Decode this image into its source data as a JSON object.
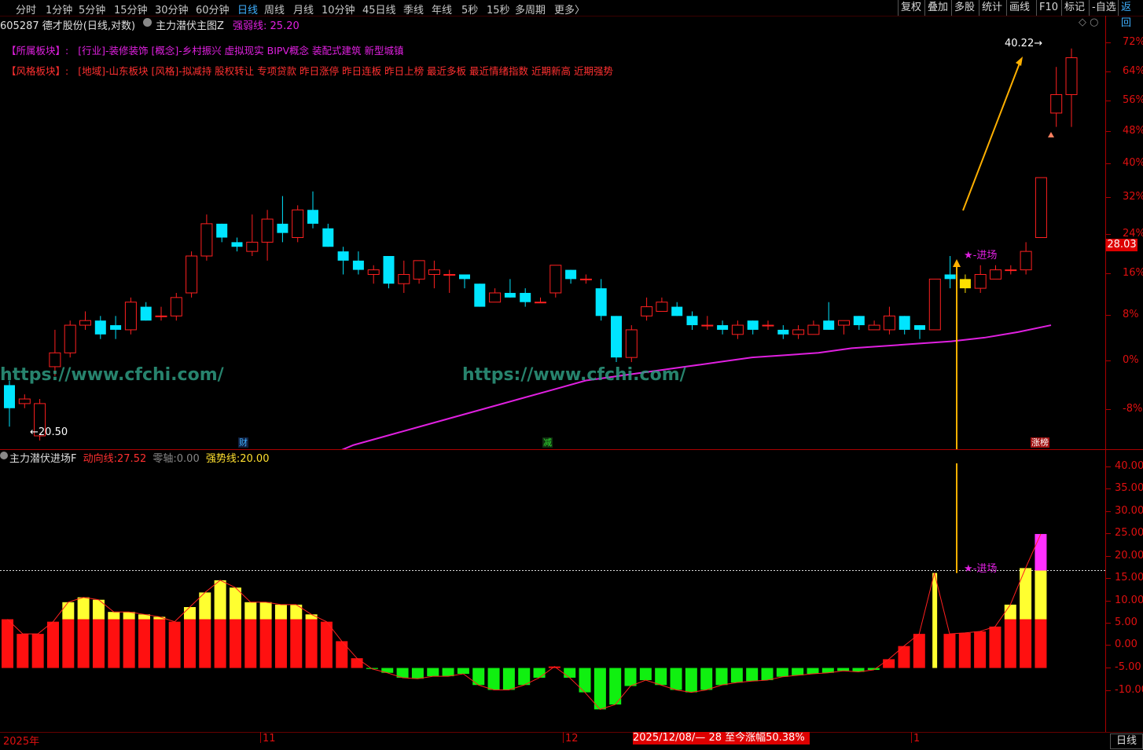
{
  "toolbar": {
    "periods": [
      "分时",
      "1分钟",
      "5分钟",
      "15分钟",
      "30分钟",
      "60分钟",
      "日线",
      "周线",
      "月线",
      "10分钟",
      "45日线",
      "季线",
      "年线",
      "5秒",
      "15秒",
      "多周期",
      "更多〉"
    ],
    "active_period": "日线",
    "right_buttons": [
      "复权",
      "叠加",
      "多股",
      "统计",
      "画线",
      "F10",
      "标记",
      "-自选",
      "返回"
    ]
  },
  "header": {
    "stock_code_title": "605287 德才股份(日线,对数)",
    "main_indicator": "主力潜伏主图Z",
    "strong_weak_label": "强弱线:",
    "strong_weak_value": "25.20"
  },
  "sectors": {
    "line1_tag": "【所属板块】:",
    "line1_text": "[行业]-装修装饰 [概念]-乡村振兴 虚拟现实 BIPV概念 装配式建筑 新型城镇",
    "line2_tag": "【风格板块】:",
    "line2_text": "[地域]-山东板块 [风格]-拟减持 股权转让 专项贷款 昨日涨停 昨日连板 昨日上榜 最近多板 最近情绪指数 近期新高 近期强势"
  },
  "watermark": "https://www.cfchi.com/",
  "price_axis": [
    "72%",
    "64%",
    "56%",
    "48%",
    "40%",
    "32%",
    "24%",
    "16%",
    "8%",
    "0%",
    "-8%"
  ],
  "current_price": "28.03",
  "high_label": "40.22",
  "low_label": "20.50",
  "entry_label": "★-进场",
  "event_markers": [
    "财",
    "减",
    "涨榜"
  ],
  "sub_indicator": {
    "name": "主力潜伏进场F",
    "line1_label": "动向线:",
    "line1_value": "27.52",
    "zero_label": "零轴:",
    "zero_value": "0.00",
    "line2_label": "强势线:",
    "line2_value": "20.00",
    "axis": [
      "40.00",
      "35.00",
      "30.00",
      "25.00",
      "20.00",
      "15.00",
      "10.00",
      "5.00",
      "0.00",
      "-5.00",
      "-10.00"
    ]
  },
  "time_axis": {
    "labels": [
      "2025年",
      "11",
      "12",
      "1"
    ],
    "highlight": "2025/12/08/— 28 至今涨幅50.38%",
    "day_button": "日线"
  },
  "colors": {
    "up": "#ff2020",
    "down": "#00e5ff",
    "highlight_candle": "#ffe000",
    "ma_line": "#e020e0",
    "arrow": "#ffb000",
    "pos_bar": "#ff1010",
    "pos_bar_top": "#ffff30",
    "neg_bar": "#10f010",
    "peak_bar": "#ff30ff"
  },
  "chart_data": {
    "type": "candlestick",
    "candles": [
      {
        "o": -1,
        "c": -6,
        "h": 0,
        "l": -10
      },
      {
        "o": -5,
        "c": -4,
        "h": -3,
        "l": -6
      },
      {
        "o": -12,
        "c": -5,
        "h": -4,
        "l": -13
      },
      {
        "o": 3,
        "c": 6,
        "h": 11,
        "l": 1
      },
      {
        "o": 6,
        "c": 12,
        "h": 13,
        "l": 5
      },
      {
        "o": 12,
        "c": 13,
        "h": 15,
        "l": 11
      },
      {
        "o": 13,
        "c": 10,
        "h": 14,
        "l": 9
      },
      {
        "o": 12,
        "c": 11,
        "h": 14,
        "l": 9
      },
      {
        "o": 11,
        "c": 17,
        "h": 18,
        "l": 10
      },
      {
        "o": 16,
        "c": 13,
        "h": 17,
        "l": 13
      },
      {
        "o": 14,
        "c": 14,
        "h": 16,
        "l": 13
      },
      {
        "o": 14,
        "c": 18,
        "h": 19,
        "l": 13
      },
      {
        "o": 19,
        "c": 27,
        "h": 28,
        "l": 18
      },
      {
        "o": 27,
        "c": 34,
        "h": 36,
        "l": 26
      },
      {
        "o": 34,
        "c": 31,
        "h": 34,
        "l": 30
      },
      {
        "o": 30,
        "c": 29,
        "h": 31,
        "l": 28
      },
      {
        "o": 28,
        "c": 30,
        "h": 36,
        "l": 27
      },
      {
        "o": 30,
        "c": 35,
        "h": 37,
        "l": 26
      },
      {
        "o": 34,
        "c": 32,
        "h": 40,
        "l": 30
      },
      {
        "o": 31,
        "c": 37,
        "h": 38,
        "l": 30
      },
      {
        "o": 37,
        "c": 34,
        "h": 41,
        "l": 33
      },
      {
        "o": 33,
        "c": 29,
        "h": 34,
        "l": 29
      },
      {
        "o": 28,
        "c": 26,
        "h": 29,
        "l": 23
      },
      {
        "o": 26,
        "c": 24,
        "h": 28,
        "l": 23
      },
      {
        "o": 23,
        "c": 24,
        "h": 25,
        "l": 21
      },
      {
        "o": 27,
        "c": 21,
        "h": 27,
        "l": 20
      },
      {
        "o": 21,
        "c": 23,
        "h": 26,
        "l": 19
      },
      {
        "o": 22,
        "c": 26,
        "h": 26,
        "l": 21
      },
      {
        "o": 23,
        "c": 24,
        "h": 26,
        "l": 20
      },
      {
        "o": 23,
        "c": 23,
        "h": 24,
        "l": 19
      },
      {
        "o": 23,
        "c": 22,
        "h": 23,
        "l": 20
      },
      {
        "o": 21,
        "c": 16,
        "h": 21,
        "l": 16
      },
      {
        "o": 17,
        "c": 19,
        "h": 20,
        "l": 17
      },
      {
        "o": 19,
        "c": 18,
        "h": 22,
        "l": 18
      },
      {
        "o": 19,
        "c": 17,
        "h": 20,
        "l": 16
      },
      {
        "o": 17,
        "c": 17,
        "h": 18,
        "l": 17
      },
      {
        "o": 19,
        "c": 25,
        "h": 25,
        "l": 18
      },
      {
        "o": 24,
        "c": 22,
        "h": 24,
        "l": 21
      },
      {
        "o": 22,
        "c": 22,
        "h": 23,
        "l": 21
      },
      {
        "o": 20,
        "c": 14,
        "h": 22,
        "l": 13
      },
      {
        "o": 14,
        "c": 5,
        "h": 14,
        "l": 4
      },
      {
        "o": 5,
        "c": 11,
        "h": 12,
        "l": 4
      },
      {
        "o": 14,
        "c": 16,
        "h": 18,
        "l": 13
      },
      {
        "o": 15,
        "c": 17,
        "h": 18,
        "l": 15
      },
      {
        "o": 16,
        "c": 14,
        "h": 17,
        "l": 14
      },
      {
        "o": 14,
        "c": 12,
        "h": 15,
        "l": 11
      },
      {
        "o": 12,
        "c": 12,
        "h": 14,
        "l": 11
      },
      {
        "o": 12,
        "c": 11,
        "h": 13,
        "l": 10
      },
      {
        "o": 10,
        "c": 12,
        "h": 13,
        "l": 9
      },
      {
        "o": 13,
        "c": 11,
        "h": 13,
        "l": 10
      },
      {
        "o": 12,
        "c": 12,
        "h": 13,
        "l": 11
      },
      {
        "o": 11,
        "c": 10,
        "h": 12,
        "l": 9
      },
      {
        "o": 10,
        "c": 11,
        "h": 12,
        "l": 9
      },
      {
        "o": 10,
        "c": 12,
        "h": 13,
        "l": 10
      },
      {
        "o": 13,
        "c": 11,
        "h": 17,
        "l": 11
      },
      {
        "o": 12,
        "c": 13,
        "h": 13,
        "l": 10
      },
      {
        "o": 14,
        "c": 12,
        "h": 14,
        "l": 11
      },
      {
        "o": 11,
        "c": 12,
        "h": 13,
        "l": 11
      },
      {
        "o": 11,
        "c": 14,
        "h": 16,
        "l": 10
      },
      {
        "o": 14,
        "c": 11,
        "h": 14,
        "l": 10
      },
      {
        "o": 12,
        "c": 11,
        "h": 12,
        "l": 9
      },
      {
        "o": 11,
        "c": 22,
        "h": 22,
        "l": 11
      },
      {
        "o": 23,
        "c": 22,
        "h": 27,
        "l": 20
      },
      {
        "o": 22,
        "c": 20,
        "h": 23,
        "l": 19
      },
      {
        "o": 20,
        "c": 23,
        "h": 25,
        "l": 19
      },
      {
        "o": 22,
        "c": 24,
        "h": 25,
        "l": 22
      },
      {
        "o": 24,
        "c": 24,
        "h": 25,
        "l": 23
      },
      {
        "o": 24,
        "c": 28,
        "h": 30,
        "l": 23
      },
      {
        "o": 31,
        "c": 44,
        "h": 44,
        "l": 31
      },
      {
        "o": 58,
        "c": 62,
        "h": 68,
        "l": 55
      },
      {
        "o": 62,
        "c": 70,
        "h": 72,
        "l": 55
      }
    ],
    "ma_line": [
      -20,
      -17,
      -14,
      -12,
      -10,
      -8,
      -6,
      -4,
      -2,
      0,
      1,
      2,
      3,
      4,
      5,
      5.5,
      6,
      7,
      7.5,
      8,
      8.5,
      9.3,
      10.5,
      12
    ],
    "oscillator": [
      10,
      7,
      7,
      9.5,
      13.5,
      14.5,
      14,
      11.5,
      11.5,
      11,
      10.5,
      9.5,
      12.5,
      15.5,
      18,
      16.5,
      13.5,
      13.5,
      13,
      13,
      11,
      9.5,
      5.5,
      2,
      -0.2,
      -1,
      -2,
      -2.2,
      -1.7,
      -1.7,
      -1.2,
      -3.5,
      -4.5,
      -4.5,
      -3.5,
      -2,
      0.3,
      -2,
      -5,
      -8.5,
      -7.5,
      -3.7,
      -2.5,
      -3.5,
      -4.5,
      -5,
      -4.5,
      -3.5,
      -3,
      -2.7,
      -2.5,
      -1.8,
      -1.5,
      -1.2,
      -1,
      -0.6,
      -0.8,
      -0.4,
      1.8,
      4.5,
      7,
      19.5,
      7,
      7.2,
      7.5,
      8.5,
      13,
      20.5,
      27.5
    ],
    "oscillator_strong_line": 20,
    "price_axis_range": [
      -12,
      74
    ],
    "osc_axis_range": [
      -12,
      42
    ]
  }
}
